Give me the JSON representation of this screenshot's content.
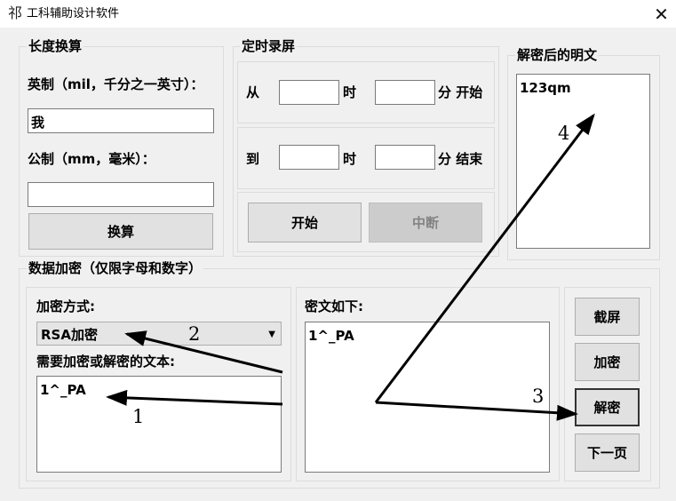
{
  "window": {
    "icon": "祁",
    "title": "工科辅助设计软件",
    "close_symbol": "✕"
  },
  "length_conv": {
    "legend": "长度换算",
    "imperial_label": "英制（mil，千分之一英寸）：",
    "imperial_value": "我",
    "metric_label": "公制（mm，毫米）：",
    "metric_value": "",
    "convert_button": "换算"
  },
  "timer_record": {
    "legend": "定时录屏",
    "from_label": "从",
    "to_label": "到",
    "hour_label": "时",
    "start_suffix": "分 开始",
    "end_suffix": "分 结束",
    "from_hour": "",
    "from_minute": "",
    "to_hour": "",
    "to_minute": "",
    "start_button": "开始",
    "interrupt_button": "中断"
  },
  "decrypted": {
    "legend": "解密后的明文",
    "text": "123qm"
  },
  "encryption": {
    "legend": "数据加密（仅限字母和数字）",
    "method_label": "加密方式:",
    "method_selected": "RSA加密",
    "input_label": "需要加密或解密的文本:",
    "input_text": "1^_PA",
    "cipher_label": "密文如下:",
    "cipher_text": "1^_PA"
  },
  "side_buttons": {
    "screenshot": "截屏",
    "encrypt": "加密",
    "decrypt": "解密",
    "next_page": "下一页"
  },
  "annotations": [
    "1",
    "2",
    "3",
    "4"
  ],
  "colors": {
    "window_bg": "#f0f0f0",
    "titlebar_bg": "#ffffff",
    "annotation": "#000000"
  }
}
